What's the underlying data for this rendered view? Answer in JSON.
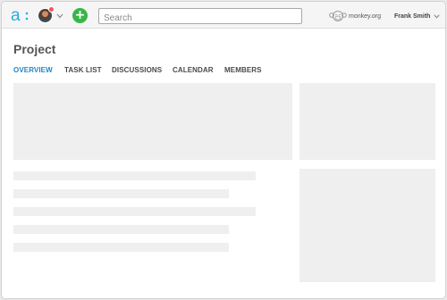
{
  "topbar": {
    "logo_icon": "asana-style-a-logo",
    "add_icon": "plus-icon",
    "add_symbol": "+",
    "notification_color": "#ff4f58",
    "add_color": "#39b54a",
    "search": {
      "placeholder": "Search",
      "value": ""
    },
    "org": {
      "icon": "monkey-icon",
      "name": "monkey.org"
    },
    "user": {
      "name": "Frank Smith",
      "icon": "chevron-down-icon"
    }
  },
  "page": {
    "title": "Project",
    "accent_color": "#1e88c8",
    "tabs": [
      {
        "label": "OVERVIEW",
        "active": true
      },
      {
        "label": "TASK LIST",
        "active": false
      },
      {
        "label": "DISCUSSIONS",
        "active": false
      },
      {
        "label": "CALENDAR",
        "active": false
      },
      {
        "label": "MEMBERS",
        "active": false
      }
    ]
  }
}
